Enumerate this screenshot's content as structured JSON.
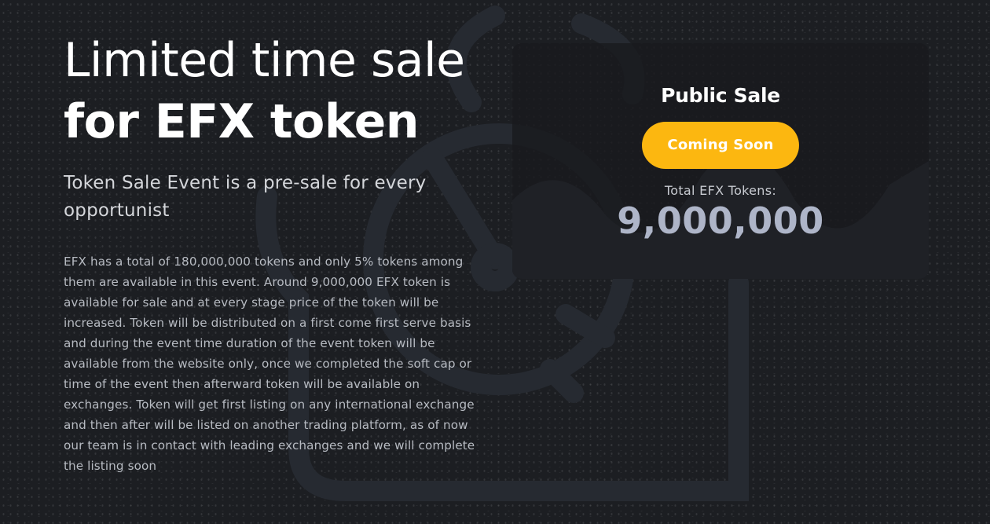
{
  "hero": {
    "headline_line1": "Limited time sale",
    "headline_line2": "for EFX token",
    "subtitle": "Token Sale Event is a pre-sale for every opportunist",
    "description": "EFX has a total of 180,000,000 tokens and only 5% tokens among them are available in this event. Around 9,000,000 EFX token is available for sale and at every stage price of the token will be increased. Token will be distributed on a first come first serve basis and during the event time duration of the event token will be available from the website only, once we completed the soft cap or time of the event then afterward token will be available on exchanges. Token will get first listing on any international exchange and then after will be listed on another trading platform, as of now our team is in contact with leading exchanges and we will complete the listing soon"
  },
  "sale_card": {
    "title": "Public Sale",
    "button_label": "Coming Soon",
    "total_label": "Total EFX Tokens:",
    "total_value": "9,000,000"
  },
  "colors": {
    "background": "#1c1e22",
    "card": "#181a1e",
    "accent": "#fcb710",
    "total_value": "#aeb5c8"
  },
  "icons": {
    "background_art": "stopwatch-outline-icon"
  }
}
